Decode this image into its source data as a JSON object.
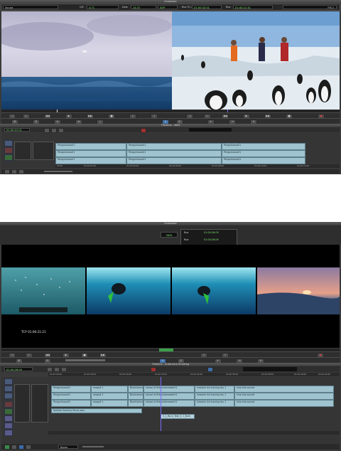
{
  "top": {
    "title": "Composer",
    "source_label": "Sound",
    "fields": [
      {
        "label": "C/E",
        "value": "4:71"
      },
      {
        "label": "Dole",
        "value": "14:37"
      },
      {
        "label": "TRT",
        "value": "SOP"
      },
      {
        "label": "Rue TC-1",
        "value": "01:00:32:01"
      },
      {
        "label": "Rue",
        "value": "01:40:21:31"
      }
    ],
    "right_field": "FM 2",
    "timeline_title": "Timeline - Wort",
    "timecode": "01:00:01:01",
    "clips_v": [
      {
        "label": "PenguinLoco01",
        "track": 0,
        "seg": 0
      },
      {
        "label": "PenguinLoco01",
        "track": 0,
        "seg": 1
      },
      {
        "label": "PenguinLoco01",
        "track": 0,
        "seg": 2
      },
      {
        "label": "PenguinLoco01",
        "track": 1,
        "seg": 0
      },
      {
        "label": "PenguinLoco01",
        "track": 1,
        "seg": 1
      },
      {
        "label": "PenguinLoco01",
        "track": 1,
        "seg": 2
      },
      {
        "label": "PenguinLoco01",
        "track": 2,
        "seg": 0
      },
      {
        "label": "PenguinLoco01",
        "track": 2,
        "seg": 1
      },
      {
        "label": "PenguinLoco01",
        "track": 2,
        "seg": 2
      }
    ],
    "ruler": [
      "00:00",
      "01:00:01:00",
      "01:00:04:00",
      "01:00:06:00",
      "01:00:08:00",
      "01:00:10:00",
      "01:00:12:00"
    ]
  },
  "bottom": {
    "title": "Composer",
    "counter": "3834",
    "fields": [
      {
        "label": "Rue",
        "value": "01:00:26:09"
      },
      {
        "label": "Rue",
        "value": "01:00:26:09"
      }
    ],
    "burnin": "TCP 01:00:21:21",
    "timeline_title": "Timeline - Antarctica Smoking",
    "timecode": "01:00:26:09",
    "v_clips": [
      {
        "track": 0,
        "items": [
          "PenguinLoco01",
          "seagull 1",
          "BlueCalmsi",
          "school of fish underwater01",
          "Iceswim Ice burning dry 1",
          "ship into sunset"
        ]
      },
      {
        "track": 1,
        "items": [
          "PenguinLoco01",
          "seagull 1",
          "BlueCalmsi",
          "school of fish underwater01",
          "Iceswim Ice burning dry 1",
          "ship into sunset"
        ]
      },
      {
        "track": 2,
        "items": [
          "PenguinLoco01",
          "seagull 1",
          "BlueCalmsi",
          "school of fish underwater01",
          "Iceswim Ice burning dry 1",
          "ship into sunset"
        ]
      }
    ],
    "music_clip": "Radiate Serenity Music.wav",
    "burn_clip": "S_1_Burn_Test_V_1_Burn",
    "ruler": [
      "01:00:26:00",
      "01:00:28:00",
      "01:00:30:00",
      "01:00:32:00",
      "01:00:34:00",
      "01:00:36:00",
      "01:00:38:00",
      "01:00:40:00",
      "01:00:42:00"
    ],
    "zoom_label": "Bipho"
  },
  "colors": {
    "accent_clip": "#9fc3cf",
    "playhead": "#7a6aff",
    "timecode": "#7de86f",
    "record": "#e04040"
  },
  "icons": [
    "play-icon",
    "stop-icon",
    "rewind-icon",
    "fast-forward-icon",
    "mark-in-icon",
    "mark-out-icon",
    "splice-icon",
    "lift-icon",
    "record-icon",
    "zoom-icon"
  ]
}
